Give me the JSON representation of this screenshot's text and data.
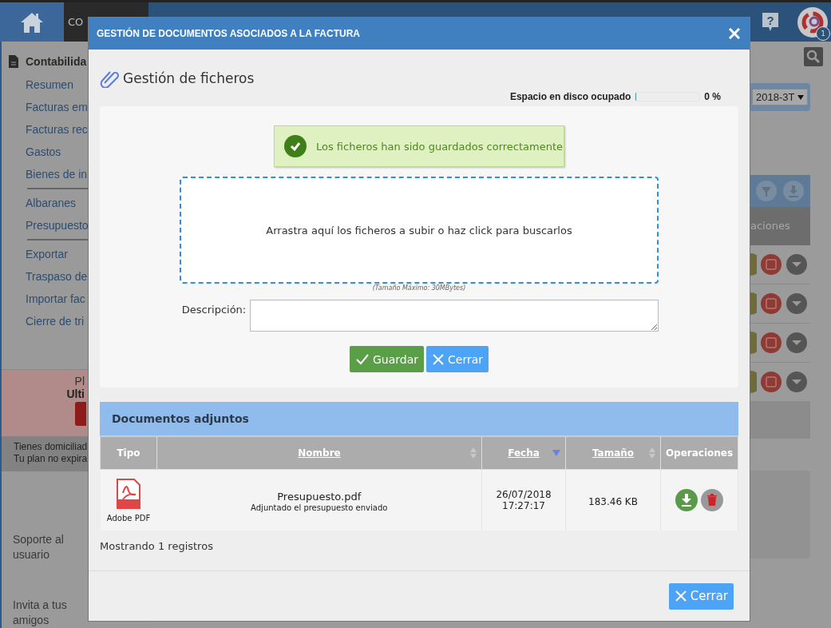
{
  "top_bar": {
    "tab_label": "CO",
    "help_glyph": "?",
    "notification_count": "1"
  },
  "sidebar": {
    "section_title": "Contabilida",
    "menu_groups": [
      [
        "Resumen",
        "Facturas em",
        "Facturas rec",
        "Gastos",
        "Bienes de in"
      ],
      [
        "Albaranes",
        "Presupuesto"
      ],
      [
        "Exportar",
        "Traspaso de",
        "Importar fac",
        "Cierre de tri"
      ]
    ],
    "plan_box": {
      "line_1": "Pl",
      "line_2": "Ulti"
    },
    "notice": [
      "Tienes domiciliad",
      "Tu plan no expira"
    ],
    "links": [
      "Soporte al usuario",
      "Invita a tus amigos"
    ]
  },
  "right_panel": {
    "period_select": "2018-3T",
    "column_header": "aciones"
  },
  "modal": {
    "title": "GESTIÓN DE DOCUMENTOS ASOCIADOS A LA FACTURA",
    "heading": "Gestión de ficheros",
    "disk_usage": {
      "label": "Espacio en disco ocupado",
      "level": 0,
      "reading": "0 %"
    },
    "alert": {
      "kind": "success",
      "text": "Los ficheros han sido guardados correctamente"
    },
    "dropzone": {
      "text": "Arrastra aquí los ficheros a subir o haz click para buscarlos",
      "note": "(Tamaño Máximo: 30MBytes)"
    },
    "description": {
      "label": "Descripción:"
    },
    "buttons": [
      {
        "kind": "save",
        "label": "Guardar"
      },
      {
        "kind": "close",
        "label": "Cerrar"
      }
    ],
    "documents": {
      "title": "Documentos adjuntos",
      "columns": [
        {
          "label": "Tipo",
          "sortable": false,
          "sorted": false
        },
        {
          "label": "Nombre",
          "sortable": true,
          "sorted": false
        },
        {
          "label": "Fecha",
          "sortable": true,
          "sorted": true
        },
        {
          "label": "Tamaño",
          "sortable": true,
          "sorted": false
        },
        {
          "label": "Operaciones",
          "sortable": false,
          "sorted": false
        }
      ],
      "rows": [
        {
          "type_label": "Adobe PDF",
          "name": "Presupuesto.pdf",
          "description": "Adjuntado el presupuesto enviado",
          "date": "26/07/2018",
          "time": "17:27:17",
          "size": "183.46 KB"
        }
      ],
      "summary": "Mostrando 1 registros"
    },
    "footer_button": {
      "label": "Cerrar"
    }
  }
}
